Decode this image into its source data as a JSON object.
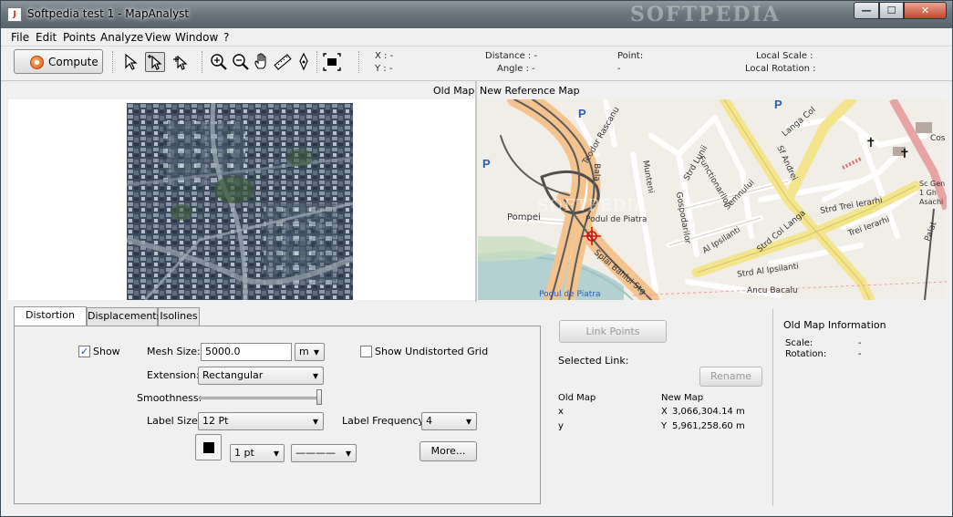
{
  "window": {
    "title": "Softpedia test 1 - MapAnalyst",
    "watermark": "SOFTPEDIA",
    "controls": {
      "minimize": "—",
      "maximize": "☐",
      "close": "✕"
    }
  },
  "menu": [
    "File",
    "Edit",
    "Points",
    "Analyze",
    "View",
    "Window",
    "?"
  ],
  "toolbar": {
    "compute_label": "Compute",
    "tools": [
      "select-arrow-icon",
      "select-point-icon",
      "add-point-icon",
      "zoom-in-icon",
      "zoom-out-icon",
      "pan-hand-icon",
      "measure-ruler-icon",
      "pen-icon",
      "fit-extent-icon"
    ],
    "readouts": {
      "x_label": "X : -",
      "y_label": "Y : -",
      "distance_label": "Distance : -",
      "angle_label": "Angle : -",
      "point_label": "Point:",
      "point_value": "-",
      "local_scale_label": "Local Scale :",
      "local_rotation_label": "Local Rotation :"
    }
  },
  "maps": {
    "old_map_title": "Old Map",
    "new_map_title": "New Reference Map",
    "new_map_labels": {
      "pompei": "Pompei",
      "podul_de_piatra_1": "Podul de Piatra",
      "podul_de_piatra_2": "Podul de Piatra",
      "splai": "Splai Bahlui Stg",
      "ipsilanti": "Al Ipsilanti",
      "ipsilanti_2": "Strd Al Ipsilanti",
      "col_langa": "Strd Col Langa",
      "trei_ierarhi": "Strd Trei Ierarhi",
      "trei_ierarhi_2": "Trei Ierarhi",
      "sf_andrei": "Sf Andrei",
      "gospodarilor": "Gospodarilor",
      "funcionarilor": "Functionarilor",
      "semnului": "Semnului",
      "sc_gen": "Sc Gen 1 Gh Asachi",
      "palat": "Palat",
      "bacalu": "Ancu Bacalu",
      "bala": "Bala",
      "munteni": "Munteni",
      "teodor": "Teodor Rascanu",
      "langa_col": "Langa Col",
      "lunii": "Strd Lunii",
      "cos": "Cos"
    }
  },
  "tabs": [
    "Distortion Grid",
    "Displacements",
    "Isolines"
  ],
  "distortion_grid": {
    "show_label": "Show",
    "show_checked": "✓",
    "mesh_size_label": "Mesh Size:",
    "mesh_size_value": "5000.0",
    "mesh_unit": "m",
    "show_undistorted_label": "Show Undistorted Grid",
    "extension_label": "Extension:",
    "extension_value": "Rectangular",
    "smoothness_label": "Smoothness:",
    "label_size_label": "Label Size:",
    "label_size_value": "12 Pt",
    "label_frequency_label": "Label Frequency:",
    "label_frequency_value": "4",
    "line_width_value": "1 pt",
    "line_style_value": "————",
    "more_label": "More..."
  },
  "link": {
    "link_points_label": "Link Points",
    "selected_link_label": "Selected Link:",
    "rename_label": "Rename",
    "old_map_header": "Old Map",
    "new_map_header": "New Map",
    "x_row_label": "x",
    "y_row_label": "y",
    "x_prefix": "X",
    "y_prefix": "Y",
    "x_value": "3,066,304.14 m",
    "y_value": "5,961,258.60 m"
  },
  "info": {
    "title": "Old Map Information",
    "scale_label": "Scale:",
    "scale_value": "-",
    "rotation_label": "Rotation:",
    "rotation_value": "-"
  }
}
